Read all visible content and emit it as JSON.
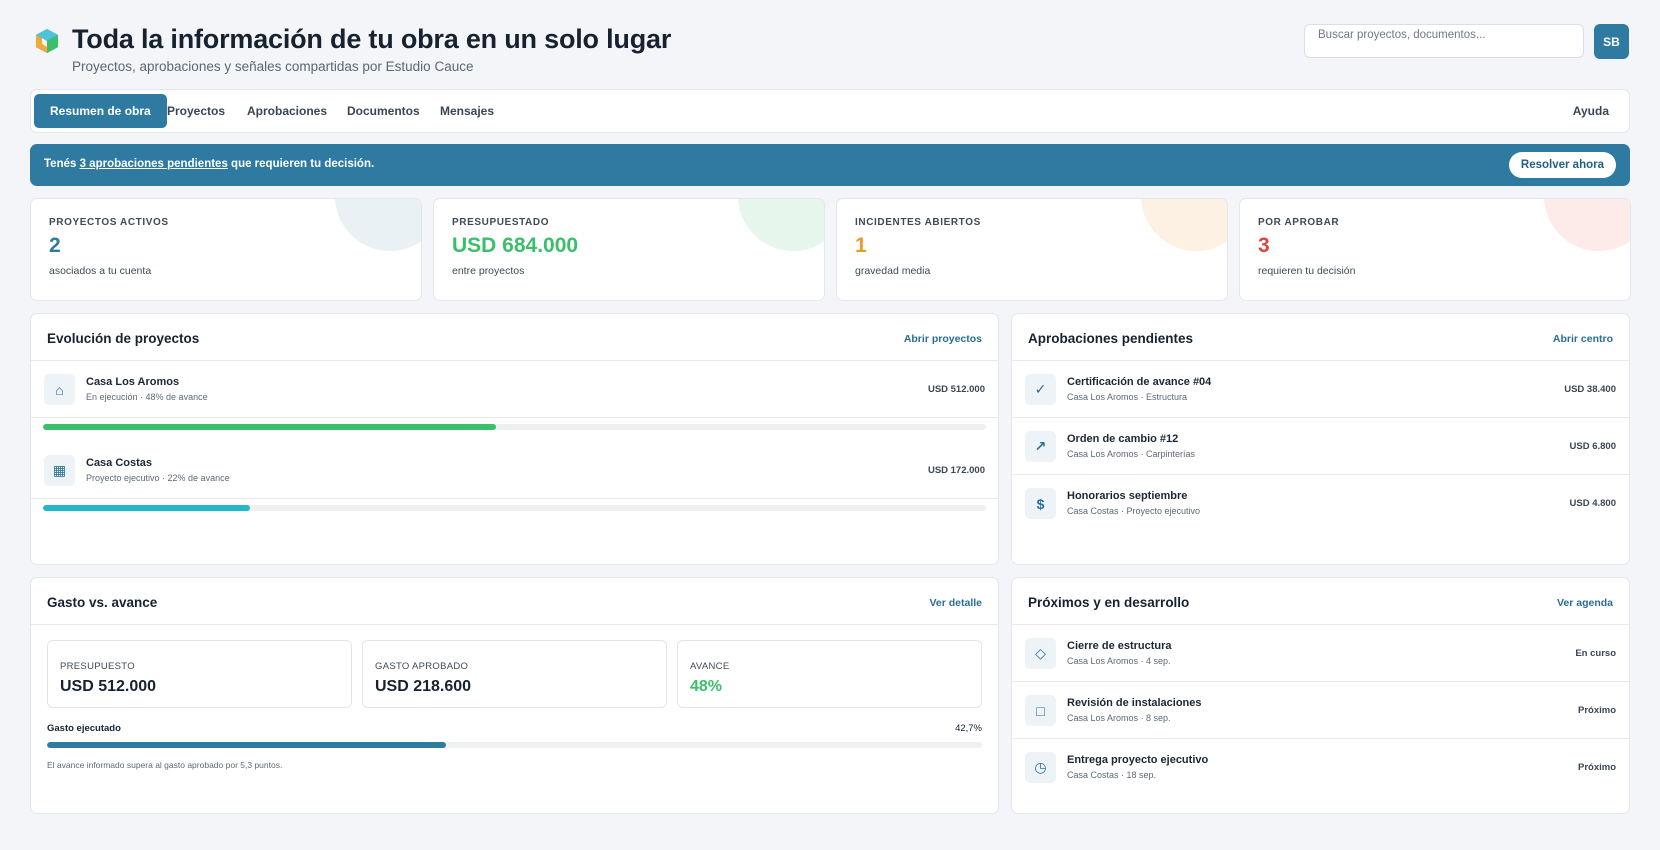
{
  "header": {
    "title": "Toda la información de tu obra en un solo lugar",
    "subtitle": "Proyectos, aprobaciones y señales compartidas por Estudio Cauce",
    "search_placeholder": "Buscar proyectos, documentos...",
    "avatar_initials": "SB"
  },
  "nav": {
    "tabs": [
      {
        "label": "Resumen de obra",
        "active": true
      },
      {
        "label": "Proyectos",
        "active": false
      },
      {
        "label": "Aprobaciones",
        "active": false
      },
      {
        "label": "Documentos",
        "active": false
      },
      {
        "label": "Mensajes",
        "active": false
      }
    ],
    "help_label": "Ayuda"
  },
  "banner": {
    "prefix": "Tenés ",
    "link": "3 aprobaciones pendientes",
    "suffix": " que requieren tu decisión.",
    "button": "Resolver ahora"
  },
  "stats": [
    {
      "label": "PROYECTOS ACTIVOS",
      "value": "2",
      "sub": "asociados a tu cuenta",
      "color": "#2e7aa1",
      "blob": "#e9f1f5"
    },
    {
      "label": "PRESUPUESTADO",
      "value": "USD 684.000",
      "sub": "entre proyectos",
      "color": "#3bbf6a",
      "blob": "#e7f6ec"
    },
    {
      "label": "INCIDENTES ABIERTOS",
      "value": "1",
      "sub": "gravedad media",
      "color": "#e89a2c",
      "blob": "#fdf1e3"
    },
    {
      "label": "POR APROBAR",
      "value": "3",
      "sub": "requieren tu decisión",
      "color": "#d9473f",
      "blob": "#fcebe9"
    }
  ],
  "evolucion": {
    "title": "Evolución de proyectos",
    "link": "Abrir proyectos",
    "projects": [
      {
        "name": "Casa Los Aromos",
        "detail": "En ejecución · 48% de avance",
        "amount": "USD 512.000",
        "progress": 0.48,
        "color": "#3bbf6a",
        "icon": "home-icon",
        "glyph": "⌂"
      },
      {
        "name": "Casa Costas",
        "detail": "Proyecto ejecutivo · 22% de avance",
        "amount": "USD 172.000",
        "progress": 0.22,
        "color": "#22b8c9",
        "icon": "building-icon",
        "glyph": "▦"
      }
    ]
  },
  "aprobaciones": {
    "title": "Aprobaciones pendientes",
    "link": "Abrir centro",
    "items": [
      {
        "title": "Certificación de avance #04",
        "sub": "Casa Los Aromos · Estructura",
        "amount": "USD 38.400",
        "icon": "check-icon",
        "glyph": "✓"
      },
      {
        "title": "Orden de cambio #12",
        "sub": "Casa Los Aromos · Carpinterías",
        "amount": "USD 6.800",
        "icon": "arrow-up-right-icon",
        "glyph": "↗"
      },
      {
        "title": "Honorarios septiembre",
        "sub": "Casa Costas · Proyecto ejecutivo",
        "amount": "USD 4.800",
        "icon": "dollar-icon",
        "glyph": "$"
      }
    ]
  },
  "gasto": {
    "title": "Gasto vs. avance",
    "link": "Ver detalle",
    "metrics": [
      {
        "label": "PRESUPUESTO",
        "value": "USD 512.000",
        "color": "#172230"
      },
      {
        "label": "GASTO APROBADO",
        "value": "USD 218.600",
        "color": "#172230"
      },
      {
        "label": "AVANCE",
        "value": "48%",
        "color": "#3bbf6a"
      }
    ],
    "executed_label": "Gasto ejecutado",
    "executed_value": "42,7%",
    "executed_fraction": 0.427,
    "executed_color": "#2e7aa1",
    "note": "El avance informado supera al gasto aprobado por 5,3 puntos."
  },
  "proximos": {
    "title": "Próximos y en desarrollo",
    "link": "Ver agenda",
    "items": [
      {
        "title": "Cierre de estructura",
        "sub": "Casa Los Aromos · 4 sep.",
        "status": "En curso",
        "icon": "diamond-icon",
        "glyph": "◇"
      },
      {
        "title": "Revisión de instalaciones",
        "sub": "Casa Los Aromos · 8 sep.",
        "status": "Próximo",
        "icon": "square-icon",
        "glyph": "□"
      },
      {
        "title": "Entrega proyecto ejecutivo",
        "sub": "Casa Costas · 18 sep.",
        "status": "Próximo",
        "icon": "clock-icon",
        "glyph": "◷"
      }
    ]
  }
}
